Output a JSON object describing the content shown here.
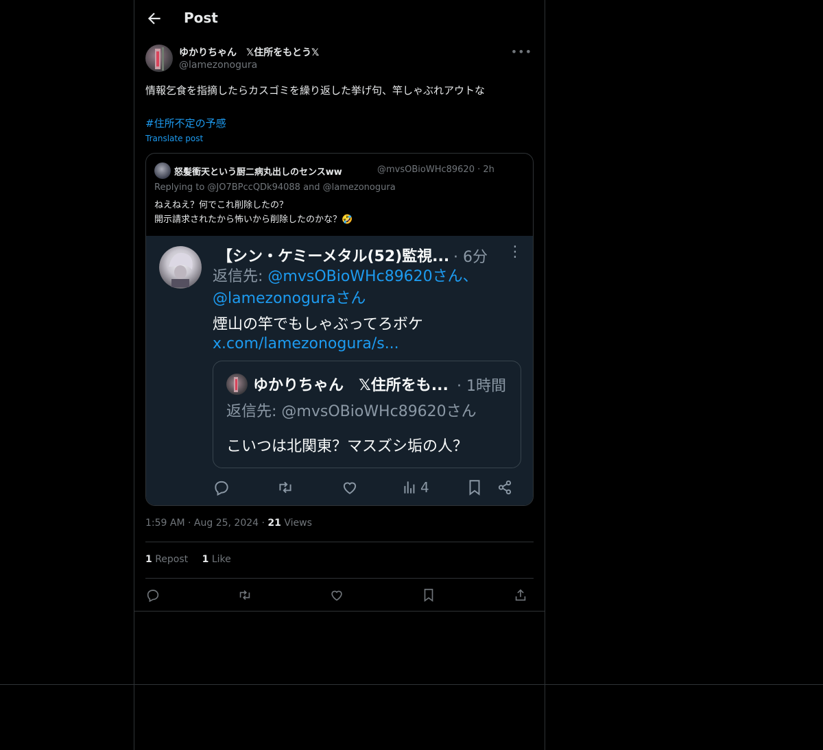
{
  "header": {
    "title": "Post"
  },
  "post": {
    "author_name": "ゆかりちゃん　𝕏住所をもとう𝕏",
    "author_handle": "@lamezonogura",
    "text": "情報乞食を指摘したらカスゴミを繰り返した挙げ句、竿しゃぶれアウトな",
    "hashtag": "#住所不定の予感",
    "translate_label": "Translate post",
    "time": "1:59 AM",
    "date": "Aug 25, 2024",
    "views_count": "21",
    "views_label": "Views",
    "reposts_count": "1",
    "reposts_label": "Repost",
    "likes_count": "1",
    "likes_label": "Like"
  },
  "quote": {
    "name": "怒髪衝天という厨二病丸出しのセンスww",
    "meta": "@mvsOBioWHc89620 · 2h",
    "replying": "Replying to @JO7BPccQDk94088 and @lamezonogura",
    "line1": "ねえねえ？何でこれ削除したの？",
    "line2": "開示請求されたから怖いから削除したのかな？🤣"
  },
  "screenshot": {
    "name": "【シン・ケミーメタル(52)監視...",
    "time": "· 6分",
    "reply_prefix": "返信先: ",
    "reply_link1": "@mvsOBioWHc89620さん、",
    "reply_link2": "@lamezonoguraさん",
    "text": "煙山の竿でもしゃぶってろボケ",
    "link": "x.com/lamezonogura/s...",
    "inner_name": "ゆかりちゃん　𝕏住所をも...",
    "inner_time": "· 1時間",
    "inner_reply": "返信先: @mvsOBioWHc89620さん",
    "inner_text": "こいつは北関東？マスズシ垢の人？",
    "views": "4"
  },
  "icons": [
    "back-arrow-icon",
    "more-icon",
    "reply-icon",
    "repost-icon",
    "like-icon",
    "views-icon",
    "bookmark-icon",
    "share-icon"
  ],
  "colors": {
    "accent": "#1d9bf0",
    "background": "#000000",
    "muted": "#71767b",
    "screenshot_bg": "#15202b"
  }
}
